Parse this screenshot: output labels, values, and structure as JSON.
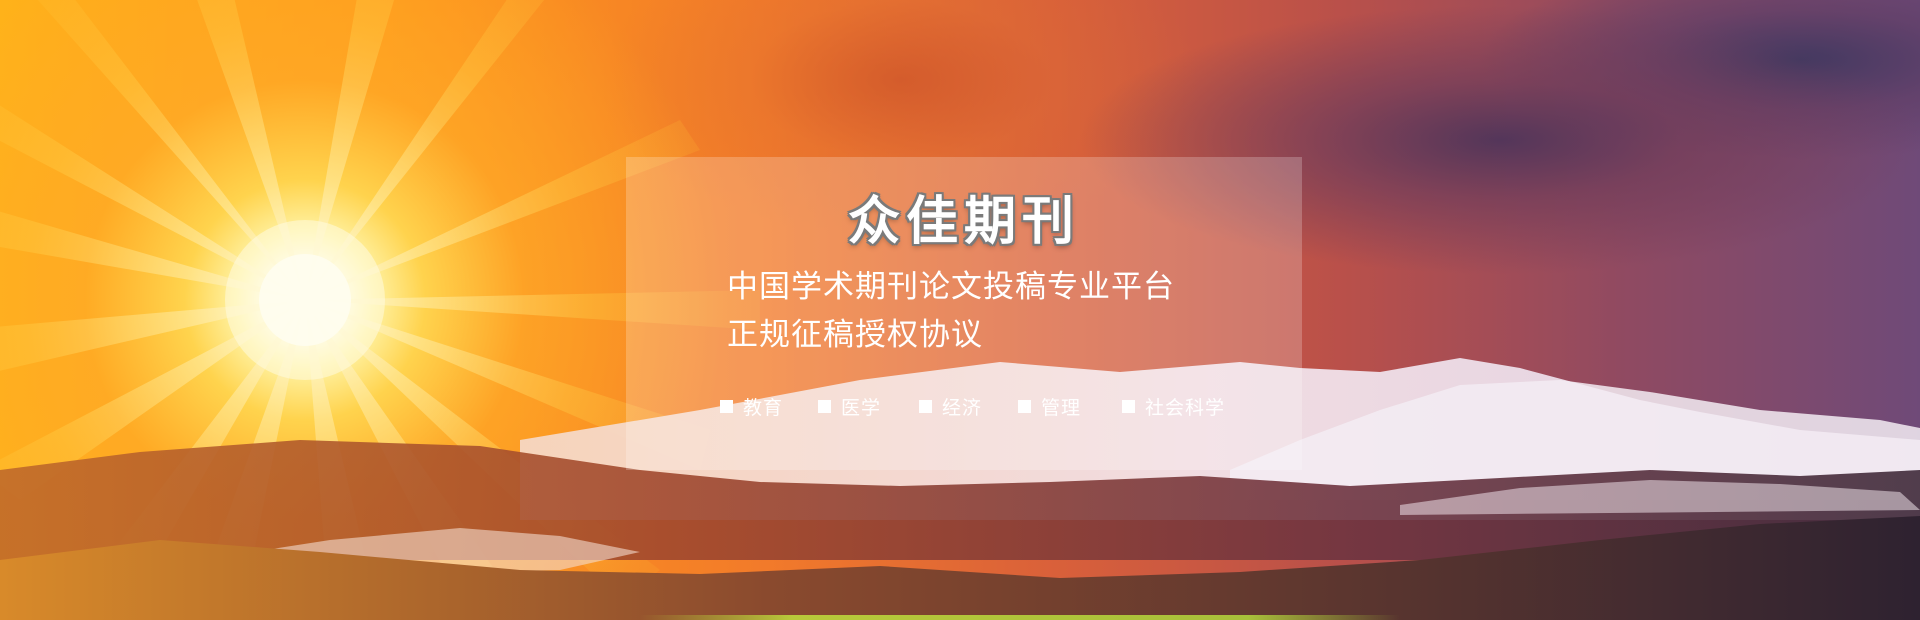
{
  "banner": {
    "brand": "众佳期刊",
    "tagline_line1": "中国学术期刊论文投稿专业平台",
    "tagline_line2": "正规征稿授权协议",
    "categories": [
      {
        "label": "教育"
      },
      {
        "label": "医学"
      },
      {
        "label": "经济"
      },
      {
        "label": "管理"
      },
      {
        "label": "社会科学"
      }
    ],
    "colors": {
      "sun": "#fff6c8",
      "sky_warm": "#ff9a1a",
      "sky_cool": "#6f4a78",
      "snow": "#f2e6f0",
      "panel_text": "#ffffff"
    }
  }
}
